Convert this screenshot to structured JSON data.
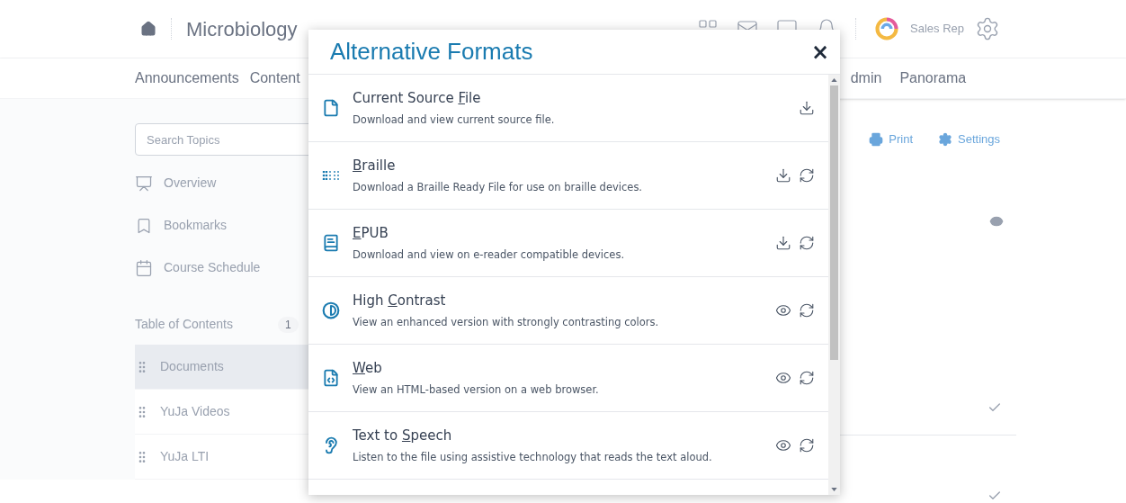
{
  "header": {
    "course_title": "Microbiology",
    "user_name": "Sales Rep"
  },
  "nav": {
    "tabs": [
      {
        "label": "Announcements"
      },
      {
        "label": "Content"
      },
      {
        "label": "dmin"
      },
      {
        "label": "Panorama"
      }
    ]
  },
  "sidebar": {
    "search": {
      "placeholder": "Search Topics"
    },
    "links": [
      {
        "kind": "overview",
        "label": "Overview"
      },
      {
        "kind": "bookmarks",
        "label": "Bookmarks"
      },
      {
        "kind": "schedule",
        "label": "Course Schedule"
      }
    ],
    "toc_heading": "Table of Contents",
    "toc_badge": "1",
    "toc_items": [
      {
        "label": "Documents",
        "selected": true
      },
      {
        "label": "YuJa Videos",
        "selected": false
      },
      {
        "label": "YuJa LTI",
        "selected": false
      }
    ]
  },
  "toolbar": {
    "print": "Print",
    "settings": "Settings"
  },
  "modal": {
    "title": "Alternative Formats",
    "close": "×",
    "formats": [
      {
        "kind": "file",
        "title": {
          "before": "Current Source ",
          "key": "F",
          "after": "ile"
        },
        "description": "Download and view current source file.",
        "download": true,
        "view": false,
        "regenerate": false
      },
      {
        "kind": "braille",
        "title": {
          "key": "B",
          "after": "raille"
        },
        "description": "Download a Braille Ready File for use on braille devices.",
        "download": true,
        "view": false,
        "regenerate": true
      },
      {
        "kind": "epub",
        "title": {
          "key": "E",
          "after": "PUB"
        },
        "description": "Download and view on e-reader compatible devices.",
        "download": true,
        "view": false,
        "regenerate": true
      },
      {
        "kind": "contrast",
        "title": {
          "before": "High ",
          "key": "C",
          "after": "ontrast"
        },
        "description": "View an enhanced version with strongly contrasting colors.",
        "download": false,
        "view": true,
        "regenerate": true
      },
      {
        "kind": "web",
        "title": {
          "key": "W",
          "after": "eb"
        },
        "description": "View an HTML-based version on a web browser.",
        "download": false,
        "view": true,
        "regenerate": true
      },
      {
        "kind": "speech",
        "title": {
          "before": "Text to ",
          "key": "S",
          "after": "peech"
        },
        "description": "Listen to the file using assistive technology that reads the text aloud.",
        "download": false,
        "view": true,
        "regenerate": true
      }
    ]
  }
}
